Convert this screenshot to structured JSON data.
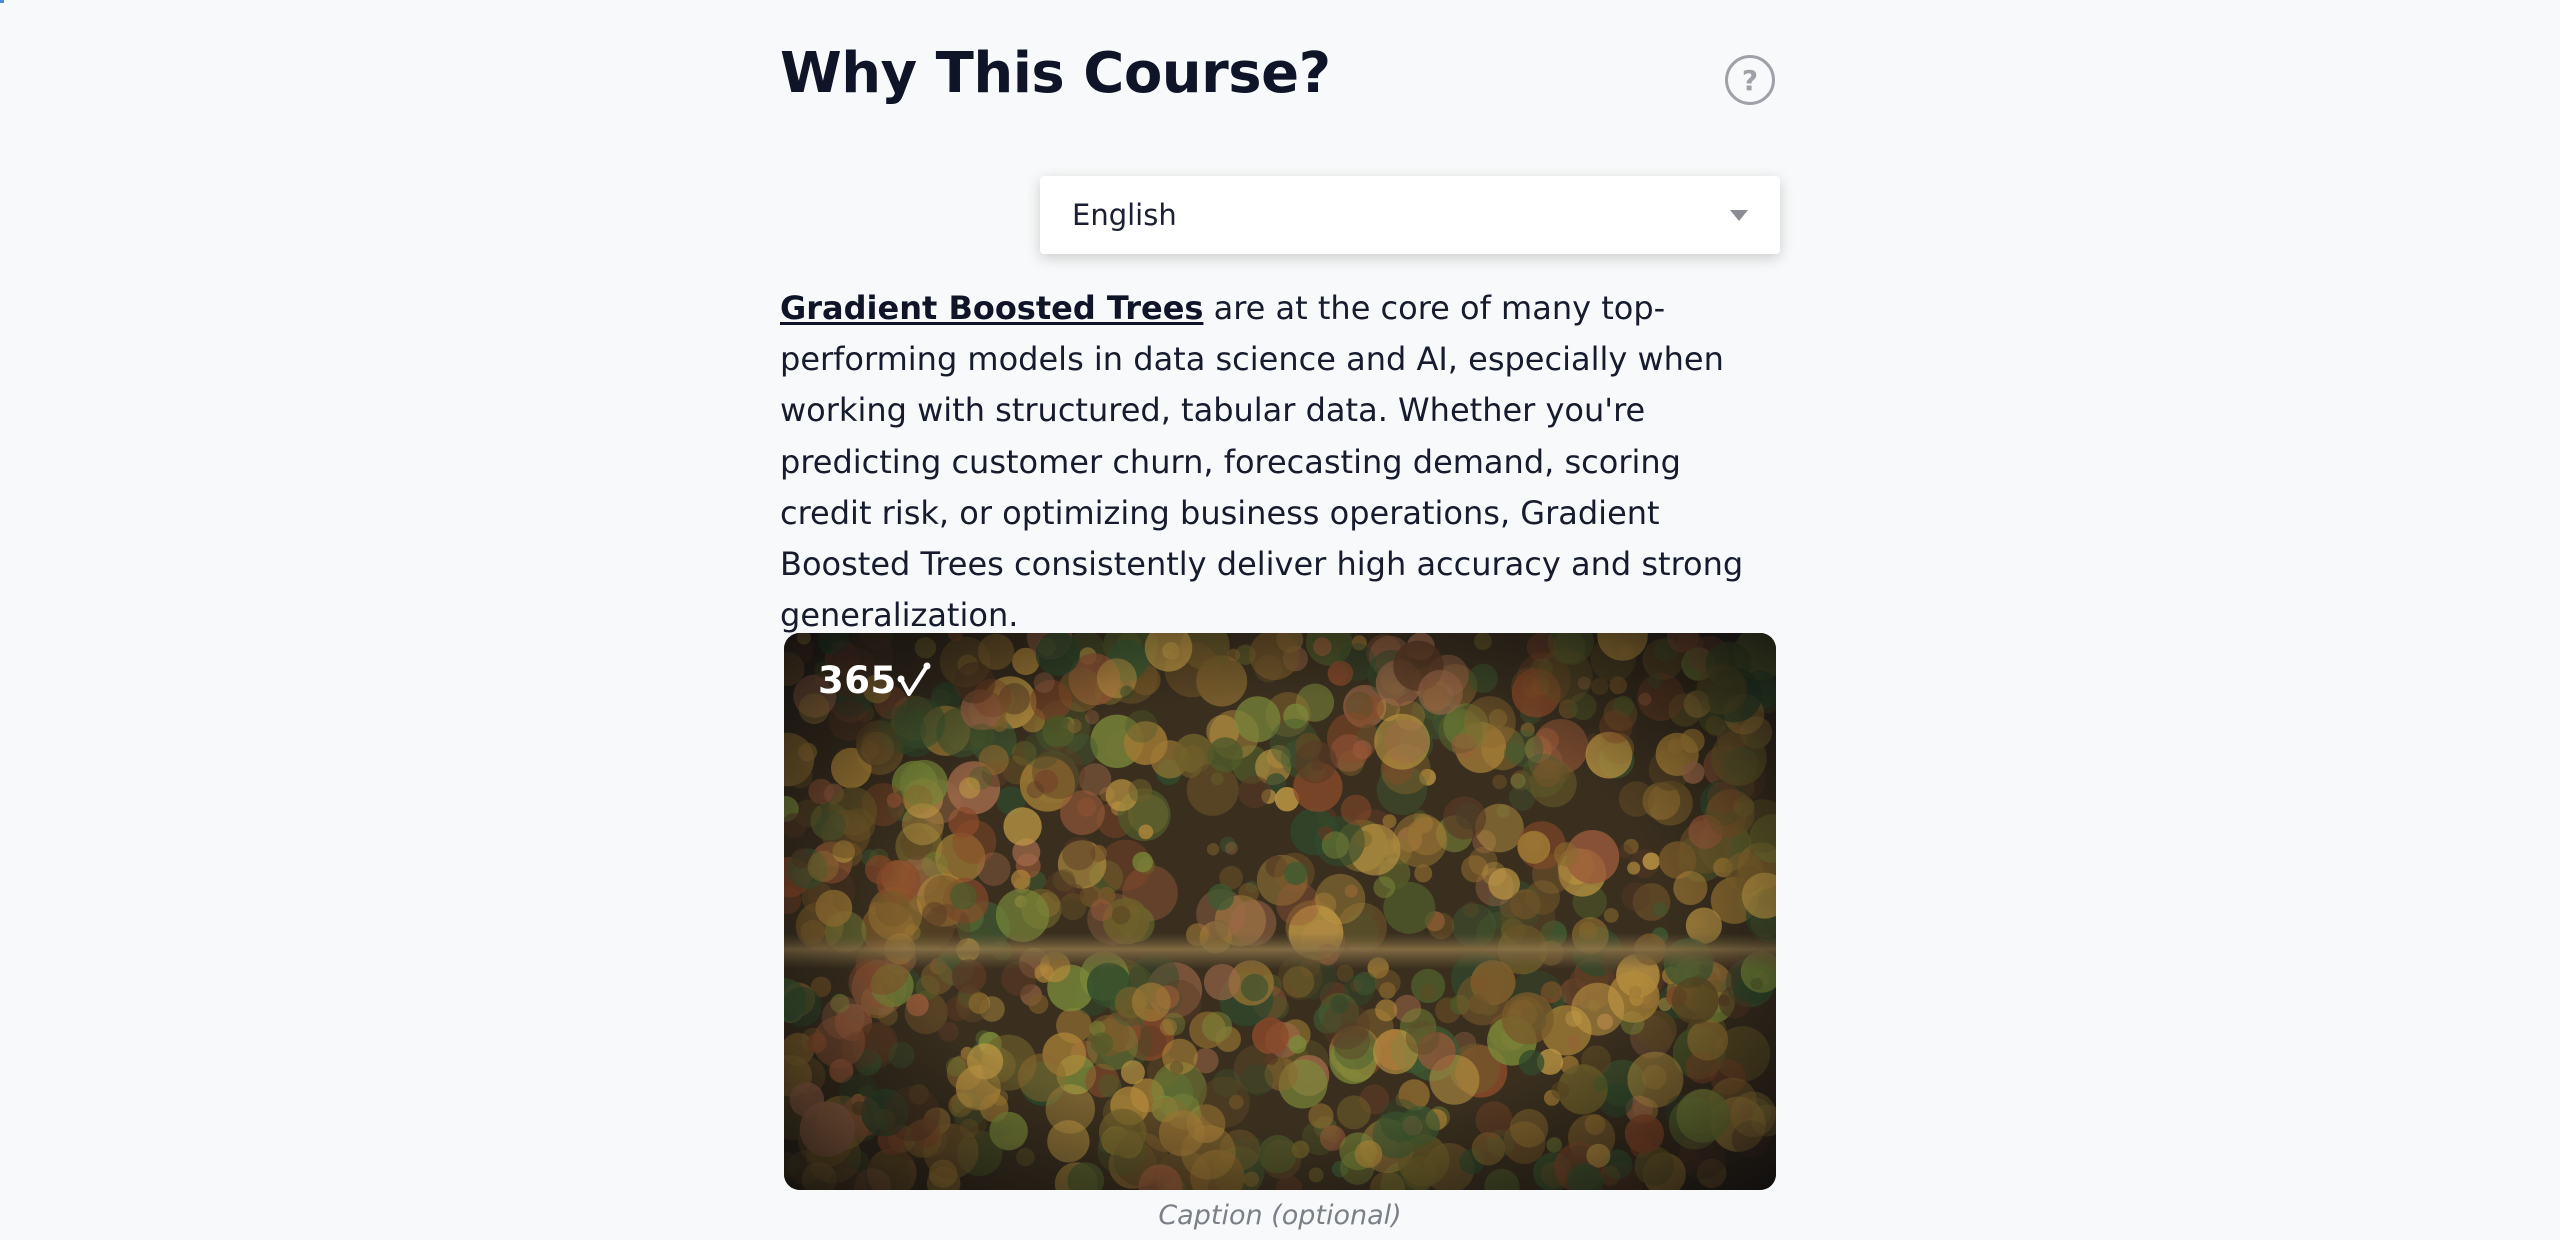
{
  "heading": {
    "title": "Why This Course?"
  },
  "help": {
    "label": "?",
    "icon": "help-circle-icon"
  },
  "language_select": {
    "selected": "English",
    "icon": "caret-down-icon"
  },
  "intro": {
    "link_text": "Gradient Boosted Trees",
    "body": " are at the core of many top-performing models in data science and AI, especially when working with structured, tabular data. Whether you're predicting customer churn, forecasting demand, scoring credit risk, or optimizing business operations, Gradient Boosted Trees consistently deliver high accuracy and strong generalization."
  },
  "figure": {
    "logo_text": "365",
    "image_description_icon": "aerial-forest-image",
    "caption": "Caption (optional)"
  },
  "colors": {
    "background": "#f8f9fa",
    "text": "#0f1428",
    "muted": "#9ea2a8",
    "caption": "#7b7f88"
  }
}
